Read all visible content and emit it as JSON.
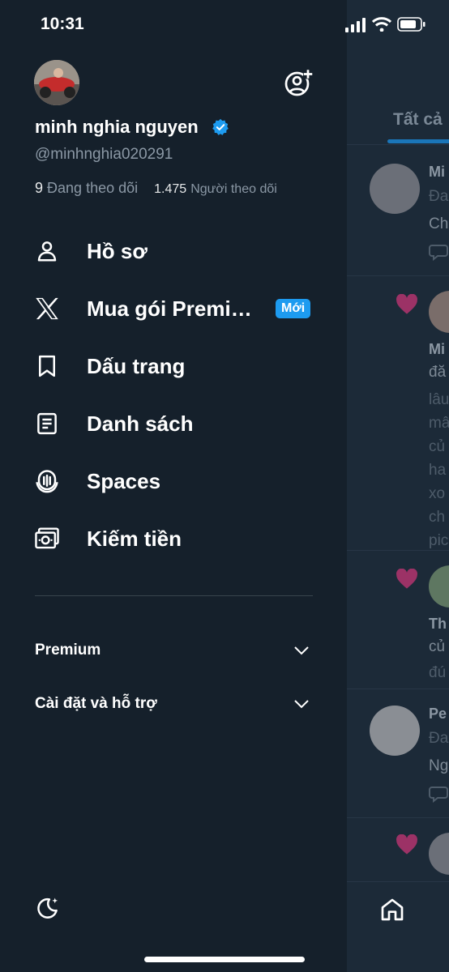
{
  "status_bar": {
    "time": "10:31"
  },
  "profile": {
    "name": "minh nghia nguyen",
    "handle": "@minhnghia020291",
    "following_count": "9",
    "following_label": "Đang theo dõi",
    "followers_count": "1.475",
    "followers_label": "Người theo dõi"
  },
  "menu": [
    {
      "label": "Hồ sơ",
      "icon": "person-icon"
    },
    {
      "label": "Mua gói Premi…",
      "icon": "x-logo-icon",
      "badge": "Mới"
    },
    {
      "label": "Dấu trang",
      "icon": "bookmark-icon"
    },
    {
      "label": "Danh sách",
      "icon": "list-icon"
    },
    {
      "label": "Spaces",
      "icon": "spaces-icon"
    },
    {
      "label": "Kiếm tiền",
      "icon": "money-icon"
    }
  ],
  "sections": [
    {
      "label": "Premium"
    },
    {
      "label": "Cài đặt và hỗ trợ"
    }
  ],
  "feed": {
    "tab_label": "Tất cả",
    "posts": [
      {
        "name": "Mi",
        "lines": [
          "Đa",
          "Ch"
        ]
      },
      {
        "name": "Mi",
        "lines": [
          "đă",
          "lâu",
          "mâ",
          "củ",
          "ha",
          "xo",
          "ch",
          "pic"
        ]
      },
      {
        "name": "Th",
        "lines": [
          "củ",
          "đú"
        ]
      },
      {
        "name": "Pe",
        "lines": [
          "Đa",
          "Ng"
        ]
      }
    ]
  },
  "colors": {
    "background": "#15202b",
    "accent": "#1d9bf0",
    "like": "#f91880"
  }
}
